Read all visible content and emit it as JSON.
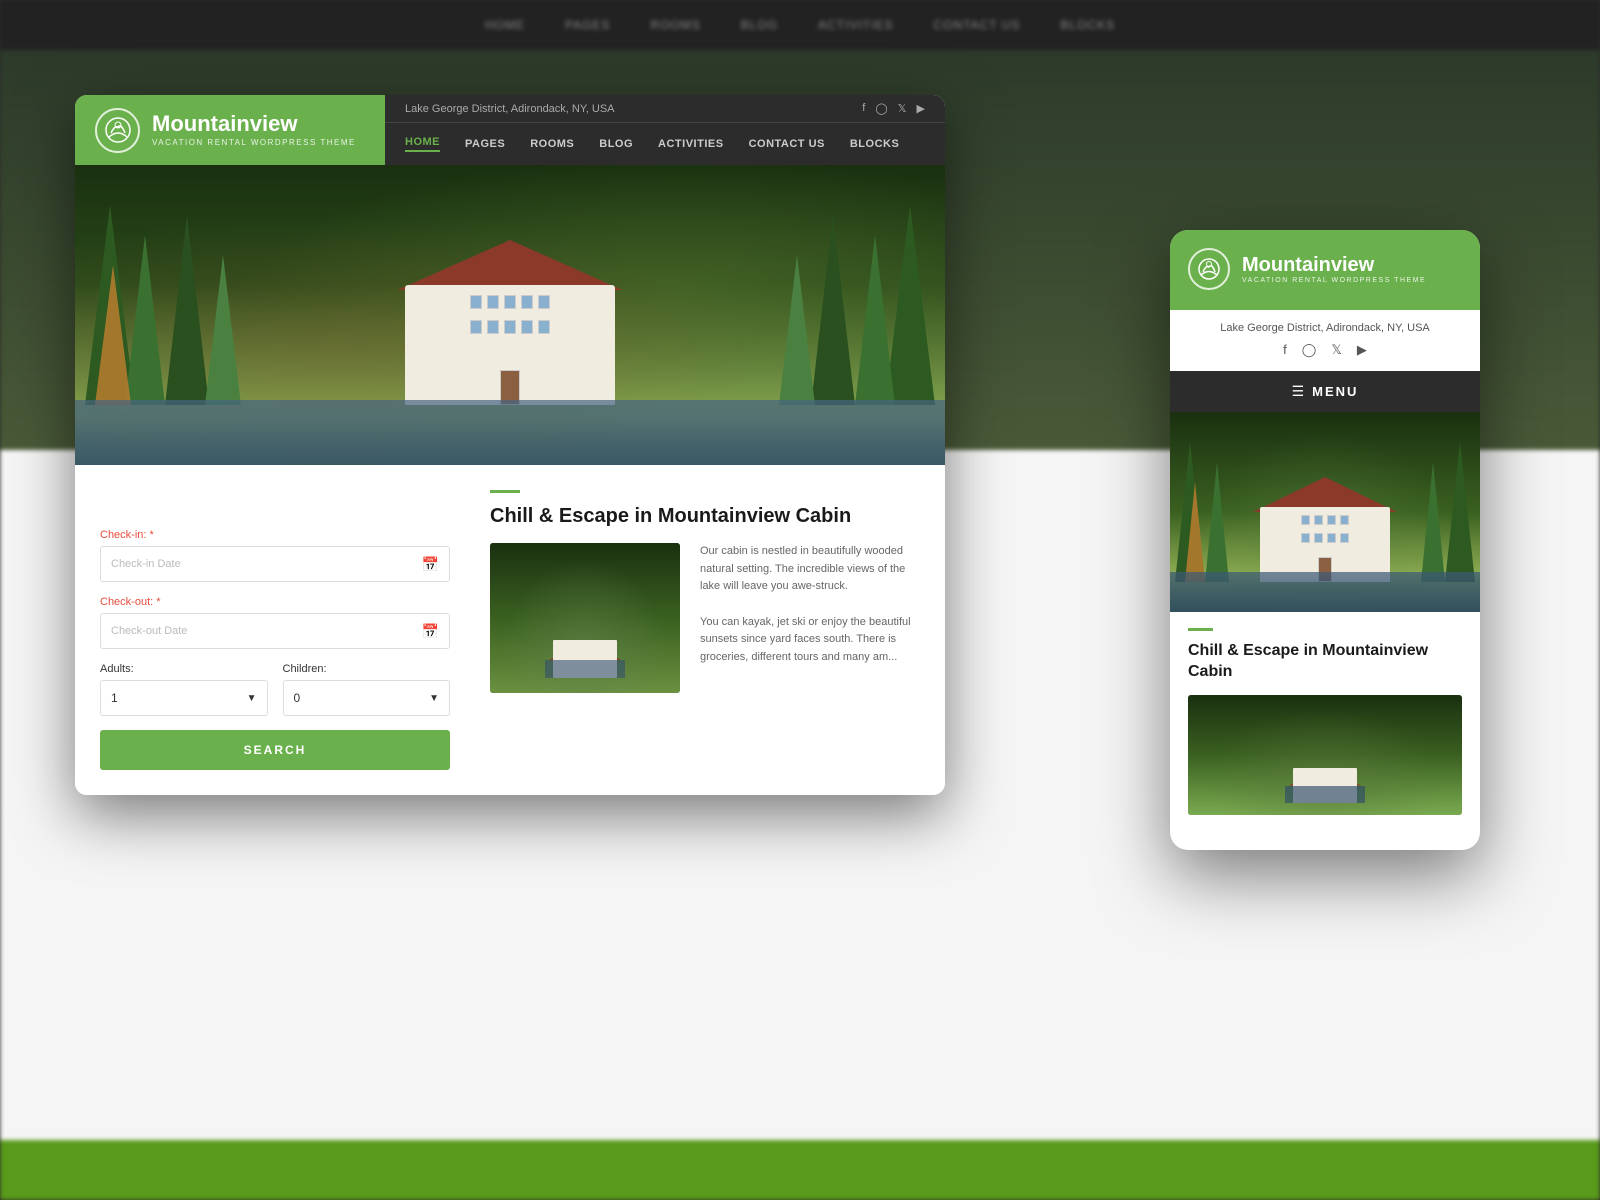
{
  "background": {
    "nav_items": [
      "HOME",
      "PAGES",
      "ROOMS",
      "BLOG",
      "ACTIVITIES",
      "CONTACT US",
      "BLOCKS"
    ]
  },
  "brand": {
    "name": "Mountainview",
    "subtitle": "VACATION RENTAL WORDPRESS THEME",
    "location": "Lake George District, Adirondack, NY, USA"
  },
  "desktop": {
    "nav": {
      "items": [
        "HOME",
        "PAGES",
        "ROOMS",
        "BLOG",
        "ACTIVITIES",
        "CONTACT US",
        "BLOCKS"
      ],
      "active": "HOME"
    },
    "social": [
      "f",
      "ig",
      "tw",
      "yt"
    ],
    "booking_form": {
      "checkin_label": "Check-in:",
      "checkin_required": "*",
      "checkin_placeholder": "Check-in Date",
      "checkout_label": "Check-out:",
      "checkout_required": "*",
      "checkout_placeholder": "Check-out Date",
      "adults_label": "Adults:",
      "adults_value": "1",
      "children_label": "Children:",
      "children_value": "0",
      "search_button": "SEARCH"
    },
    "content": {
      "title": "Chill & Escape in Mountainview Cabin",
      "text1": "Our cabin is nestled in beautifully wooded natural setting. The incredible views of the lake will leave you awe-struck.",
      "text2": "You can kayak, jet ski or enjoy the beautiful sunsets since yard faces south. There is groceries, different tours and many am..."
    }
  },
  "mobile": {
    "menu_label": "MENU",
    "content": {
      "title": "Chill & Escape in Mountainview Cabin"
    }
  },
  "colors": {
    "green": "#6ab04c",
    "dark": "#2c2c2c",
    "white": "#ffffff"
  }
}
